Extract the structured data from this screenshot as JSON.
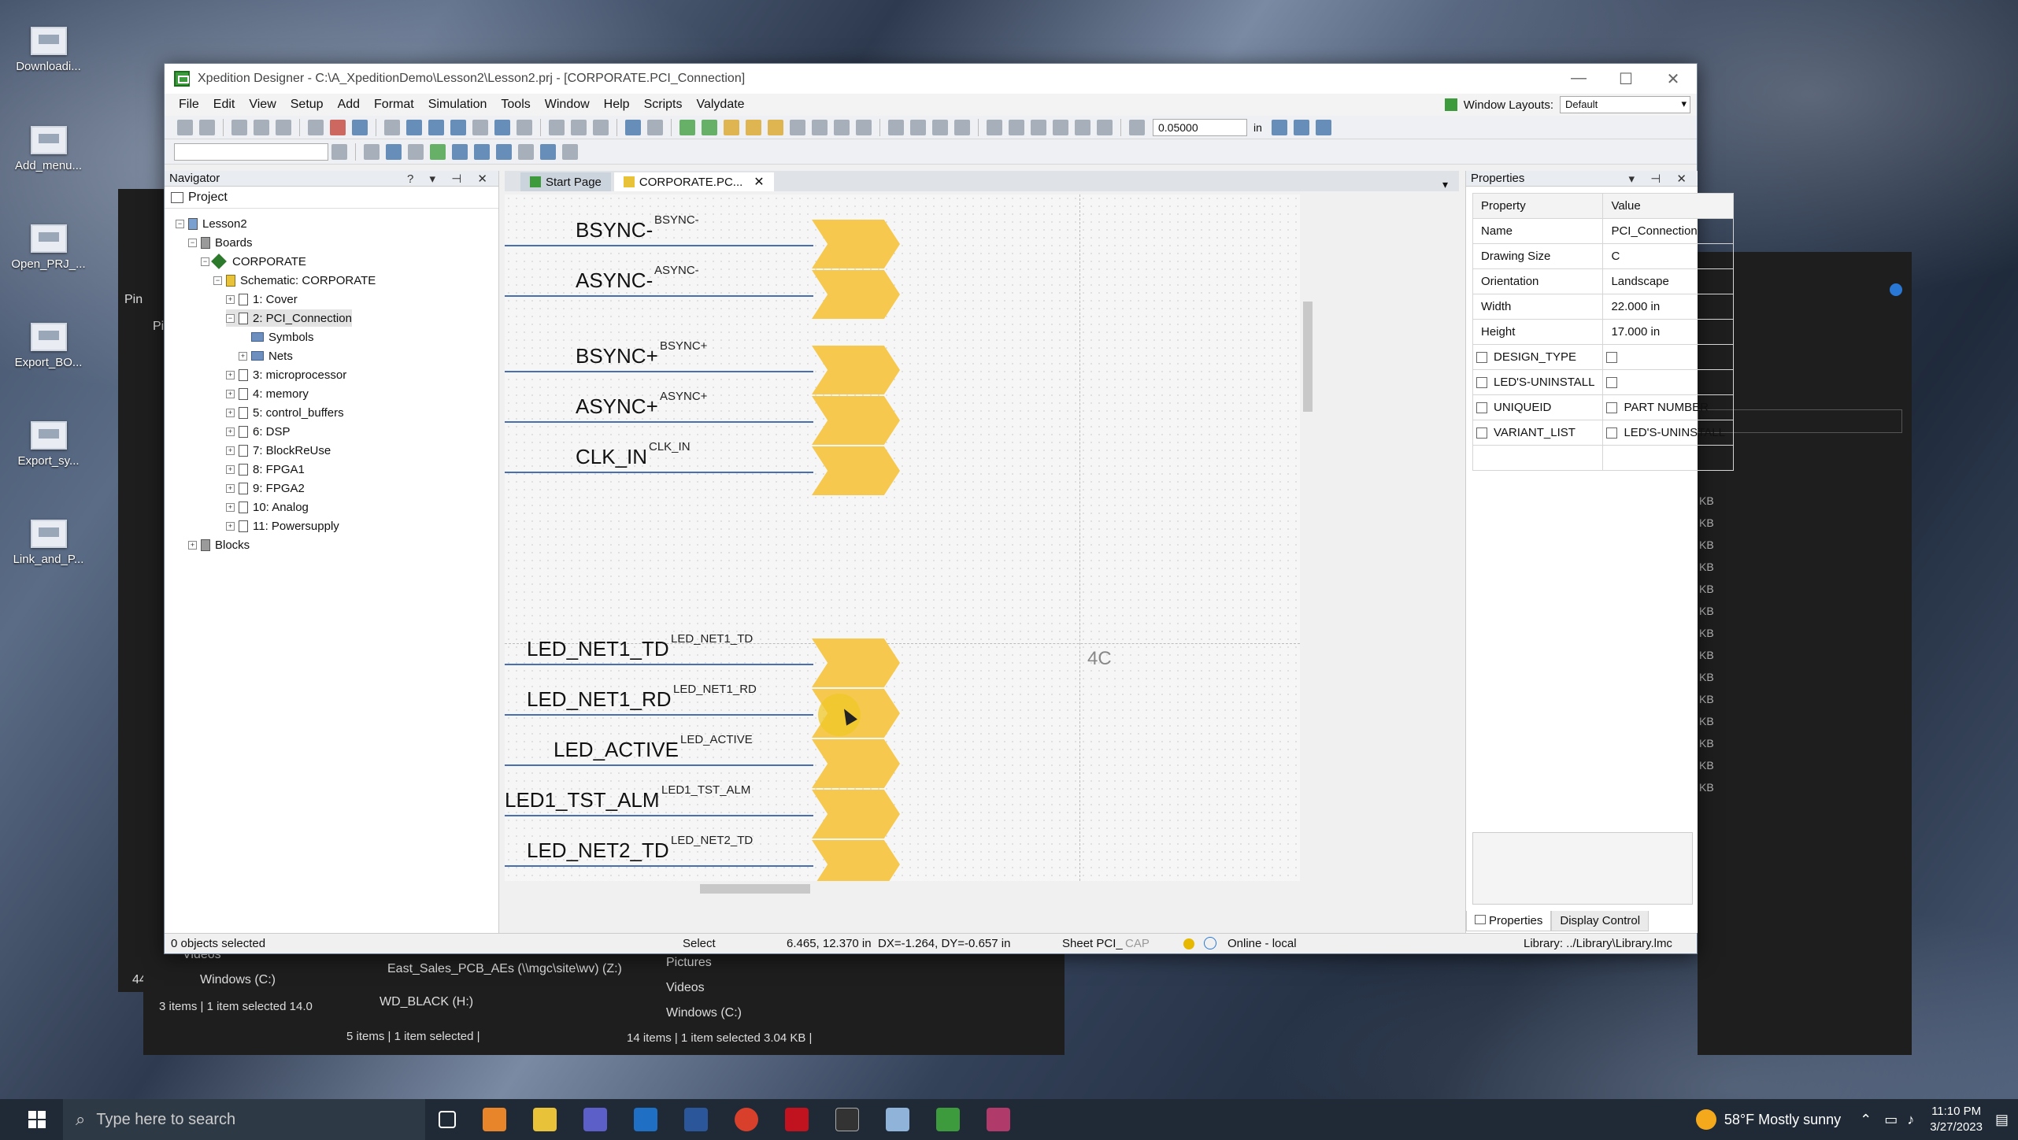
{
  "desktop": {
    "icons": [
      "Downloadi...",
      "Add_menu...",
      "Open_PRJ_...",
      "Export_BO...",
      "Export_sy...",
      "Link_and_P..."
    ]
  },
  "bg_explorer": {
    "left_items": [
      "Videos",
      "Windows (C:)"
    ],
    "left_status": "3 items  |  1 item selected 14.0",
    "mid_items": [
      "East_Sales_PCB_AEs (\\\\mgc\\site\\wv) (Z:)",
      "WD_BLACK (H:)"
    ],
    "mid_status": "5 items  |  1 item selected  |",
    "right_items": [
      "Pictures",
      "Videos",
      "Windows (C:)"
    ],
    "right_status": "14 items  |  1 item selected 3.04 KB  |",
    "side_labels": [
      "Pin",
      "Pi"
    ],
    "kb": [
      "KB",
      "KB",
      "KB",
      "KB",
      "KB",
      "KB",
      "KB",
      "KB",
      "KB",
      "KB",
      "KB",
      "KB",
      "KB",
      "KB"
    ],
    "num44": "44"
  },
  "window": {
    "title": "Xpedition Designer - C:\\A_XpeditionDemo\\Lesson2\\Lesson2.prj - [CORPORATE.PCI_Connection]",
    "menu": [
      "File",
      "Edit",
      "View",
      "Setup",
      "Add",
      "Format",
      "Simulation",
      "Tools",
      "Window",
      "Help",
      "Scripts",
      "Valydate"
    ],
    "window_layouts_label": "Window Layouts:",
    "window_layouts_value": "Default",
    "grid_value": "0.05000",
    "grid_unit": "in"
  },
  "navigator": {
    "title": "Navigator",
    "controls": "? ▾ ⊣ ✕",
    "tab": "Project",
    "tree": [
      {
        "label": "Lesson2",
        "indent": 0
      },
      {
        "label": "Boards",
        "indent": 1
      },
      {
        "label": "CORPORATE",
        "indent": 2
      },
      {
        "label": "Schematic: CORPORATE",
        "indent": 3
      },
      {
        "label": "1: Cover",
        "indent": 4
      },
      {
        "label": "2: PCI_Connection",
        "indent": 4
      },
      {
        "label": "Symbols",
        "indent": 5
      },
      {
        "label": "Nets",
        "indent": 5
      },
      {
        "label": "3: microprocessor",
        "indent": 4
      },
      {
        "label": "4: memory",
        "indent": 4
      },
      {
        "label": "5: control_buffers",
        "indent": 4
      },
      {
        "label": "6: DSP",
        "indent": 4
      },
      {
        "label": "7: BlockReUse",
        "indent": 4
      },
      {
        "label": "8: FPGA1",
        "indent": 4
      },
      {
        "label": "9: FPGA2",
        "indent": 4
      },
      {
        "label": "10: Analog",
        "indent": 4
      },
      {
        "label": "11: Powersupply",
        "indent": 4
      },
      {
        "label": "Blocks",
        "indent": 1
      }
    ]
  },
  "doc": {
    "tabs": [
      "Start Page",
      "CORPORATE.PC..."
    ],
    "zone_label": "4C",
    "nets": [
      {
        "name": "BSYNC-",
        "sup": "BSYNC-"
      },
      {
        "name": "ASYNC-",
        "sup": "ASYNC-"
      },
      {
        "name": "BSYNC+",
        "sup": "BSYNC+"
      },
      {
        "name": "ASYNC+",
        "sup": "ASYNC+"
      },
      {
        "name": "CLK_IN",
        "sup": "CLK_IN"
      },
      {
        "name": "LED_NET1_TD",
        "sup": "LED_NET1_TD"
      },
      {
        "name": "LED_NET1_RD",
        "sup": "LED_NET1_RD"
      },
      {
        "name": "LED_ACTIVE",
        "sup": "LED_ACTIVE"
      },
      {
        "name": "LED1_TST_ALM",
        "sup": "LED1_TST_ALM"
      },
      {
        "name": "LED_NET2_TD",
        "sup": "LED_NET2_TD"
      }
    ]
  },
  "properties": {
    "title": "Properties",
    "header": [
      "Property",
      "Value"
    ],
    "rows": [
      {
        "prop": "Name",
        "value": "PCI_Connection"
      },
      {
        "prop": "Drawing Size",
        "value": "C"
      },
      {
        "prop": "Orientation",
        "value": "Landscape"
      },
      {
        "prop": "Width",
        "value": "22.000 in"
      },
      {
        "prop": "Height",
        "value": "17.000 in"
      }
    ],
    "check_rows": [
      {
        "prop": "DESIGN_TYPE",
        "value": ""
      },
      {
        "prop": "LED'S-UNINSTALL",
        "value": ""
      },
      {
        "prop": "UNIQUEID",
        "value": "PART NUMBER"
      },
      {
        "prop": "VARIANT_LIST",
        "value": "LED'S-UNINSTALL"
      }
    ],
    "tabs": [
      "Properties",
      "Display Control"
    ]
  },
  "status": {
    "selected": "0 objects selected",
    "mode": "Select",
    "coords": "6.465, 12.370 in",
    "delta": "DX=-1.264, DY=-0.657 in",
    "sheet": "Sheet PCI_",
    "cap": "CAP",
    "online": "Online - local",
    "library": "Library: ../Library\\Library.lmc"
  },
  "taskbar": {
    "search_placeholder": "Type here to search",
    "weather": "58°F  Mostly sunny",
    "time": "11:10 PM",
    "date": "3/27/2023"
  }
}
